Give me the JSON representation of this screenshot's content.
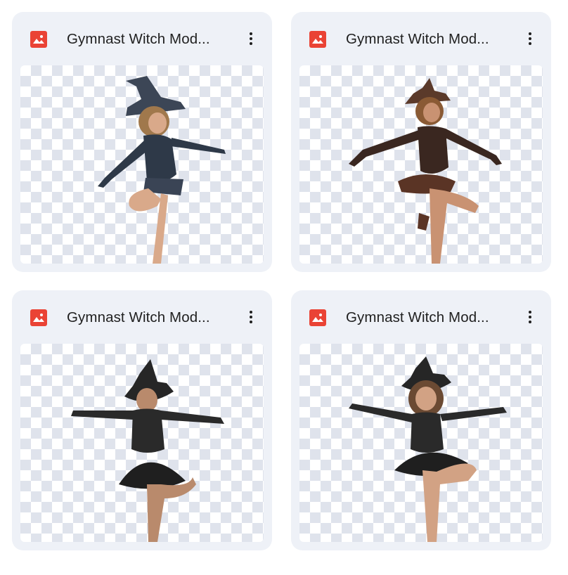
{
  "files": [
    {
      "title": "Gymnast Witch Mod...",
      "icon": "image-file-icon",
      "icon_color": "#ea4335",
      "more_icon": "more-vert-icon"
    },
    {
      "title": "Gymnast Witch Mod...",
      "icon": "image-file-icon",
      "icon_color": "#ea4335",
      "more_icon": "more-vert-icon"
    },
    {
      "title": "Gymnast Witch Mod...",
      "icon": "image-file-icon",
      "icon_color": "#ea4335",
      "more_icon": "more-vert-icon"
    },
    {
      "title": "Gymnast Witch Mod...",
      "icon": "image-file-icon",
      "icon_color": "#ea4335",
      "more_icon": "more-vert-icon"
    }
  ]
}
